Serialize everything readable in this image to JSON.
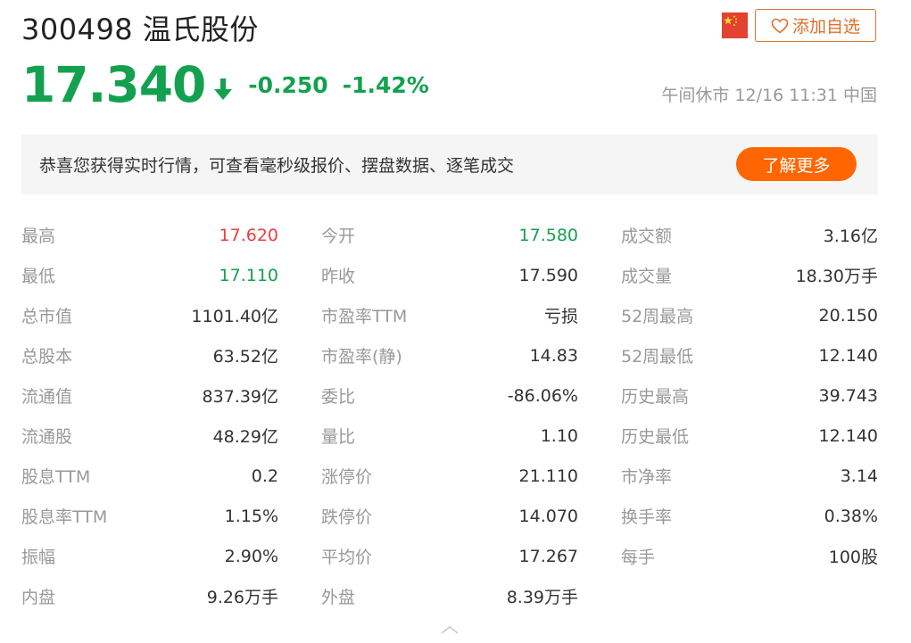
{
  "header": {
    "code": "300498",
    "name": "温氏股份",
    "add_watchlist": "添加自选",
    "flag_icon": "china-flag-icon",
    "heart_icon": "heart-icon"
  },
  "quote": {
    "price": "17.340",
    "change": "-0.250",
    "change_pct": "-1.42%",
    "arrow_icon": "arrow-down-icon",
    "status": "午间休市 12/16 11:31 中国"
  },
  "banner": {
    "text": "恭喜您获得实时行情，可查看毫秒级报价、摆盘数据、逐笔成交",
    "button": "了解更多"
  },
  "stats": [
    [
      {
        "label": "最高",
        "value": "17.620",
        "tone": "up"
      },
      {
        "label": "今开",
        "value": "17.580",
        "tone": "down"
      },
      {
        "label": "成交额",
        "value": "3.16亿",
        "tone": ""
      }
    ],
    [
      {
        "label": "最低",
        "value": "17.110",
        "tone": "down"
      },
      {
        "label": "昨收",
        "value": "17.590",
        "tone": ""
      },
      {
        "label": "成交量",
        "value": "18.30万手",
        "tone": ""
      }
    ],
    [
      {
        "label": "总市值",
        "value": "1101.40亿",
        "tone": ""
      },
      {
        "label": "市盈率TTM",
        "value": "亏损",
        "tone": ""
      },
      {
        "label": "52周最高",
        "value": "20.150",
        "tone": ""
      }
    ],
    [
      {
        "label": "总股本",
        "value": "63.52亿",
        "tone": ""
      },
      {
        "label": "市盈率(静)",
        "value": "14.83",
        "tone": ""
      },
      {
        "label": "52周最低",
        "value": "12.140",
        "tone": ""
      }
    ],
    [
      {
        "label": "流通值",
        "value": "837.39亿",
        "tone": ""
      },
      {
        "label": "委比",
        "value": "-86.06%",
        "tone": ""
      },
      {
        "label": "历史最高",
        "value": "39.743",
        "tone": ""
      }
    ],
    [
      {
        "label": "流通股",
        "value": "48.29亿",
        "tone": ""
      },
      {
        "label": "量比",
        "value": "1.10",
        "tone": ""
      },
      {
        "label": "历史最低",
        "value": "12.140",
        "tone": ""
      }
    ],
    [
      {
        "label": "股息TTM",
        "value": "0.2",
        "tone": ""
      },
      {
        "label": "涨停价",
        "value": "21.110",
        "tone": ""
      },
      {
        "label": "市净率",
        "value": "3.14",
        "tone": ""
      }
    ],
    [
      {
        "label": "股息率TTM",
        "value": "1.15%",
        "tone": ""
      },
      {
        "label": "跌停价",
        "value": "14.070",
        "tone": ""
      },
      {
        "label": "换手率",
        "value": "0.38%",
        "tone": ""
      }
    ],
    [
      {
        "label": "振幅",
        "value": "2.90%",
        "tone": ""
      },
      {
        "label": "平均价",
        "value": "17.267",
        "tone": ""
      },
      {
        "label": "每手",
        "value": "100股",
        "tone": ""
      }
    ],
    [
      {
        "label": "内盘",
        "value": "9.26万手",
        "tone": ""
      },
      {
        "label": "外盘",
        "value": "8.39万手",
        "tone": ""
      }
    ]
  ],
  "footer": {
    "collapse_icon": "chevron-up-icon"
  },
  "colors": {
    "up": "#e84040",
    "down": "#13a14f",
    "accent": "#ff6600",
    "label": "#999999",
    "watch_border": "#d9762f"
  }
}
